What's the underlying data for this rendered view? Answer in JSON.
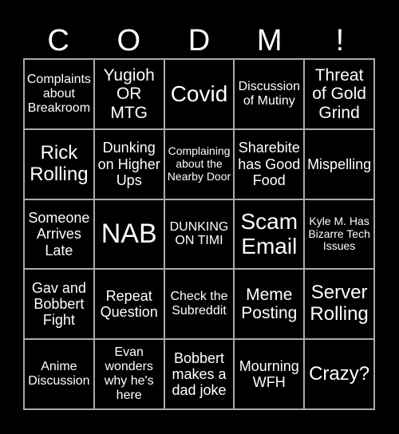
{
  "title": [
    "C",
    "O",
    "D",
    "M",
    "!"
  ],
  "cells": [
    "Complaints about Breakroom",
    "Yugioh OR MTG",
    "Covid",
    "Discussion of Mutiny",
    "Threat of Gold Grind",
    "Rick Rolling",
    "Dunking on Higher Ups",
    "Complaining about the Nearby Door",
    "Sharebite has Good Food",
    "Mispelling",
    "Someone Arrives Late",
    "NAB",
    "DUNKING ON TIMI",
    "Scam Email",
    "Kyle M. Has Bizarre Tech Issues",
    "Gav and Bobbert Fight",
    "Repeat Question",
    "Check the Subreddit",
    "Meme Posting",
    "Server Rolling",
    "Anime Discussion",
    "Evan wonders why he's here",
    "Bobbert makes a dad joke",
    "Mourning WFH",
    "Crazy?"
  ]
}
